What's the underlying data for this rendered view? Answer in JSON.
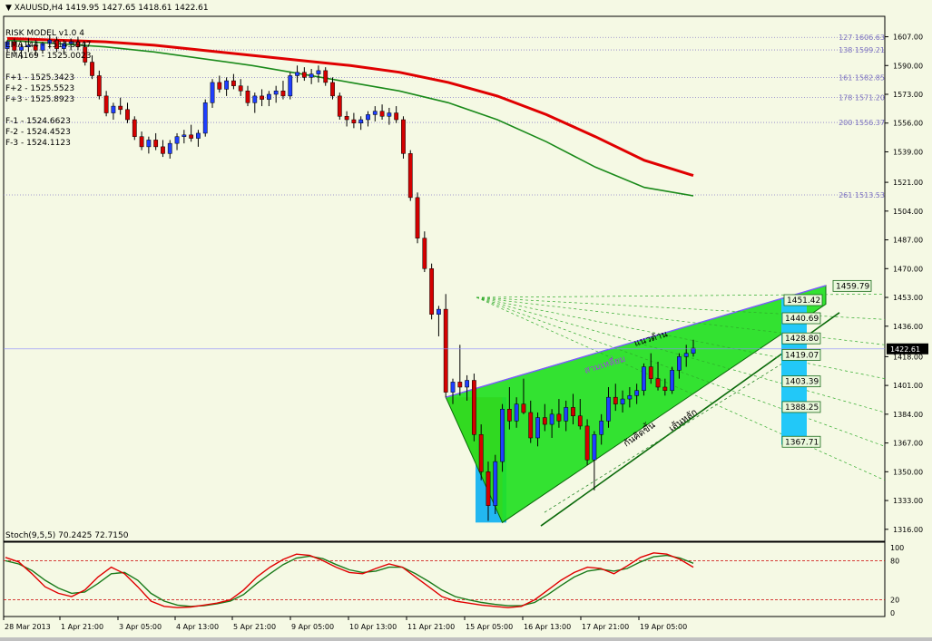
{
  "header": {
    "arrow": "▼",
    "title": "XAUUSD,H4  1419.95 1427.65 1418.61 1422.61"
  },
  "indicators": {
    "risk_model": "RISK MODEL v1.0 4",
    "ema144": "EMA144 - 1514.3947",
    "ema169": "EMA169 - 1525.0023",
    "fplus": [
      "F+1 - 1525.3423",
      "F+2 - 1525.5523",
      "F+3 - 1525.8923"
    ],
    "fminus": [
      "F-1 - 1524.6623",
      "F-2 - 1524.4523",
      "F-3 - 1524.1123"
    ]
  },
  "fib_levels": [
    {
      "label": "127  1606.63",
      "value": 1606.63
    },
    {
      "label": "138  1599.21",
      "value": 1599.21
    },
    {
      "label": "161  1582.85",
      "value": 1582.85
    },
    {
      "label": "178  1571.20",
      "value": 1571.2
    },
    {
      "label": "200  1556.37",
      "value": 1556.37
    },
    {
      "label": "261  1513.53",
      "value": 1513.53
    }
  ],
  "price_boxes": [
    {
      "label": "1459.79",
      "value": 1459.79
    },
    {
      "label": "1451.42",
      "value": 1451.42
    },
    {
      "label": "1440.69",
      "value": 1440.69
    },
    {
      "label": "1428.80",
      "value": 1428.8
    },
    {
      "label": "1419.07",
      "value": 1419.07
    },
    {
      "label": "1403.39",
      "value": 1403.39
    },
    {
      "label": "1388.25",
      "value": 1388.25
    },
    {
      "label": "1367.71",
      "value": 1367.71
    }
  ],
  "annotations": {
    "resistance": "แนวต้าน",
    "channel": "สามเหลี่ยม",
    "support1": "กันคิดขึ้น",
    "support2": "เส้นหลัก"
  },
  "stoch": {
    "label": "Stoch(9,5,5) 70.2425 72.7150",
    "levels": [
      {
        "label": "100",
        "value": 100
      },
      {
        "label": "80",
        "value": 80
      },
      {
        "label": "20",
        "value": 20
      },
      {
        "label": "0",
        "value": 0
      }
    ]
  },
  "current_price": {
    "label": "1422.61",
    "value": 1422.61
  },
  "colors": {
    "background": "#f5f9e4",
    "bull": "#1f3fff",
    "bear": "#d40000",
    "ema_fast": "#1a8a1a",
    "ema_slow": "#e00000",
    "triangle": "#22e022",
    "stoch_main": "#e00000",
    "stoch_signal": "#1a7a1a"
  },
  "chart_data": {
    "type": "candlestick",
    "symbol": "XAUUSD",
    "timeframe": "H4",
    "y_ticks": [
      1607.0,
      1590.0,
      1573.0,
      1556.0,
      1539.0,
      1521.0,
      1504.0,
      1487.0,
      1470.0,
      1453.0,
      1436.0,
      1418.0,
      1401.0,
      1384.0,
      1367.0,
      1350.0,
      1333.0,
      1316.0
    ],
    "ylim": [
      1310,
      1618
    ],
    "x_labels": [
      "28 Mar 2013",
      "1 Apr 21:00",
      "3 Apr 05:00",
      "4 Apr 13:00",
      "5 Apr 21:00",
      "9 Apr 05:00",
      "10 Apr 13:00",
      "11 Apr 21:00",
      "15 Apr 05:00",
      "16 Apr 13:00",
      "17 Apr 21:00",
      "19 Apr 05:00"
    ],
    "candles": [
      [
        1600,
        1605,
        1598,
        1604
      ],
      [
        1604,
        1606,
        1597,
        1599
      ],
      [
        1599,
        1603,
        1594,
        1601
      ],
      [
        1601,
        1606,
        1598,
        1602
      ],
      [
        1602,
        1605,
        1596,
        1599
      ],
      [
        1599,
        1604,
        1597,
        1603
      ],
      [
        1603,
        1608,
        1600,
        1605
      ],
      [
        1605,
        1607,
        1598,
        1600
      ],
      [
        1600,
        1605,
        1597,
        1603
      ],
      [
        1603,
        1606,
        1599,
        1604
      ],
      [
        1604,
        1607,
        1599,
        1601
      ],
      [
        1601,
        1604,
        1590,
        1592
      ],
      [
        1592,
        1596,
        1582,
        1584
      ],
      [
        1584,
        1587,
        1570,
        1572
      ],
      [
        1572,
        1575,
        1560,
        1562
      ],
      [
        1562,
        1568,
        1558,
        1566
      ],
      [
        1566,
        1571,
        1561,
        1564
      ],
      [
        1564,
        1568,
        1556,
        1558
      ],
      [
        1558,
        1560,
        1546,
        1548
      ],
      [
        1548,
        1551,
        1540,
        1542
      ],
      [
        1542,
        1548,
        1538,
        1546
      ],
      [
        1546,
        1550,
        1540,
        1542
      ],
      [
        1542,
        1546,
        1536,
        1538
      ],
      [
        1538,
        1546,
        1535,
        1544
      ],
      [
        1544,
        1550,
        1540,
        1548
      ],
      [
        1548,
        1552,
        1544,
        1549
      ],
      [
        1549,
        1555,
        1545,
        1547
      ],
      [
        1547,
        1552,
        1542,
        1550
      ],
      [
        1550,
        1570,
        1548,
        1568
      ],
      [
        1568,
        1582,
        1565,
        1580
      ],
      [
        1580,
        1584,
        1574,
        1576
      ],
      [
        1576,
        1583,
        1572,
        1581
      ],
      [
        1581,
        1585,
        1576,
        1578
      ],
      [
        1578,
        1582,
        1572,
        1575
      ],
      [
        1575,
        1578,
        1566,
        1568
      ],
      [
        1568,
        1574,
        1562,
        1572
      ],
      [
        1572,
        1576,
        1566,
        1570
      ],
      [
        1570,
        1575,
        1566,
        1573
      ],
      [
        1573,
        1578,
        1568,
        1575
      ],
      [
        1575,
        1581,
        1570,
        1572
      ],
      [
        1572,
        1586,
        1570,
        1584
      ],
      [
        1584,
        1590,
        1580,
        1586
      ],
      [
        1586,
        1589,
        1581,
        1583
      ],
      [
        1583,
        1588,
        1579,
        1585
      ],
      [
        1585,
        1590,
        1580,
        1587
      ],
      [
        1587,
        1589,
        1578,
        1580
      ],
      [
        1580,
        1583,
        1570,
        1572
      ],
      [
        1572,
        1574,
        1558,
        1560
      ],
      [
        1560,
        1563,
        1554,
        1558
      ],
      [
        1558,
        1562,
        1553,
        1556
      ],
      [
        1556,
        1560,
        1552,
        1558
      ],
      [
        1558,
        1563,
        1554,
        1561
      ],
      [
        1561,
        1566,
        1557,
        1563
      ],
      [
        1563,
        1567,
        1558,
        1560
      ],
      [
        1560,
        1565,
        1555,
        1562
      ],
      [
        1562,
        1566,
        1556,
        1558
      ],
      [
        1558,
        1560,
        1535,
        1538
      ],
      [
        1538,
        1540,
        1510,
        1512
      ],
      [
        1512,
        1515,
        1485,
        1488
      ],
      [
        1488,
        1492,
        1468,
        1470
      ],
      [
        1470,
        1473,
        1440,
        1443
      ],
      [
        1443,
        1448,
        1430,
        1446
      ],
      [
        1446,
        1455,
        1394,
        1397
      ],
      [
        1397,
        1405,
        1390,
        1403
      ],
      [
        1403,
        1425,
        1395,
        1400
      ],
      [
        1400,
        1407,
        1392,
        1404
      ],
      [
        1404,
        1408,
        1368,
        1372
      ],
      [
        1372,
        1378,
        1345,
        1350
      ],
      [
        1350,
        1356,
        1321,
        1330
      ],
      [
        1330,
        1360,
        1325,
        1356
      ],
      [
        1356,
        1390,
        1350,
        1387
      ],
      [
        1387,
        1400,
        1375,
        1380
      ],
      [
        1380,
        1394,
        1376,
        1390
      ],
      [
        1390,
        1405,
        1384,
        1385
      ],
      [
        1385,
        1392,
        1367,
        1370
      ],
      [
        1370,
        1385,
        1365,
        1382
      ],
      [
        1382,
        1390,
        1374,
        1378
      ],
      [
        1378,
        1387,
        1370,
        1384
      ],
      [
        1384,
        1393,
        1376,
        1380
      ],
      [
        1380,
        1392,
        1374,
        1388
      ],
      [
        1388,
        1396,
        1378,
        1383
      ],
      [
        1383,
        1393,
        1375,
        1377
      ],
      [
        1377,
        1381,
        1354,
        1357
      ],
      [
        1357,
        1374,
        1339,
        1372
      ],
      [
        1372,
        1384,
        1366,
        1380
      ],
      [
        1380,
        1400,
        1376,
        1394
      ],
      [
        1394,
        1402,
        1386,
        1390
      ],
      [
        1390,
        1398,
        1385,
        1393
      ],
      [
        1393,
        1400,
        1388,
        1395
      ],
      [
        1395,
        1402,
        1390,
        1398
      ],
      [
        1398,
        1414,
        1395,
        1412
      ],
      [
        1412,
        1420,
        1402,
        1405
      ],
      [
        1405,
        1415,
        1398,
        1400
      ],
      [
        1400,
        1405,
        1395,
        1398
      ],
      [
        1398,
        1412,
        1396,
        1410
      ],
      [
        1410,
        1420,
        1405,
        1418
      ],
      [
        1418,
        1425,
        1412,
        1420
      ],
      [
        1420,
        1428,
        1418,
        1423
      ]
    ],
    "ema144_series": [
      1605,
      1603,
      1601,
      1598,
      1594,
      1590,
      1585,
      1580,
      1575,
      1568,
      1558,
      1545,
      1530,
      1518,
      1513
    ],
    "ema169_series": [
      1606,
      1605,
      1604,
      1602,
      1599,
      1596,
      1593,
      1590,
      1586,
      1580,
      1572,
      1561,
      1548,
      1534,
      1525
    ],
    "stoch_k": [
      85,
      78,
      60,
      40,
      30,
      25,
      35,
      55,
      70,
      60,
      40,
      18,
      10,
      8,
      9,
      12,
      15,
      20,
      35,
      55,
      70,
      82,
      90,
      88,
      80,
      70,
      62,
      60,
      68,
      75,
      70,
      55,
      40,
      25,
      18,
      15,
      12,
      10,
      8,
      10,
      20,
      35,
      50,
      62,
      70,
      68,
      60,
      72,
      85,
      92,
      90,
      82,
      70
    ],
    "stoch_d": [
      80,
      75,
      65,
      50,
      38,
      30,
      32,
      45,
      60,
      62,
      50,
      30,
      18,
      12,
      10,
      11,
      14,
      18,
      28,
      45,
      60,
      74,
      84,
      87,
      83,
      74,
      66,
      62,
      64,
      70,
      70,
      60,
      48,
      35,
      25,
      20,
      16,
      13,
      11,
      11,
      16,
      28,
      42,
      55,
      64,
      67,
      64,
      68,
      78,
      86,
      88,
      84,
      76
    ]
  }
}
